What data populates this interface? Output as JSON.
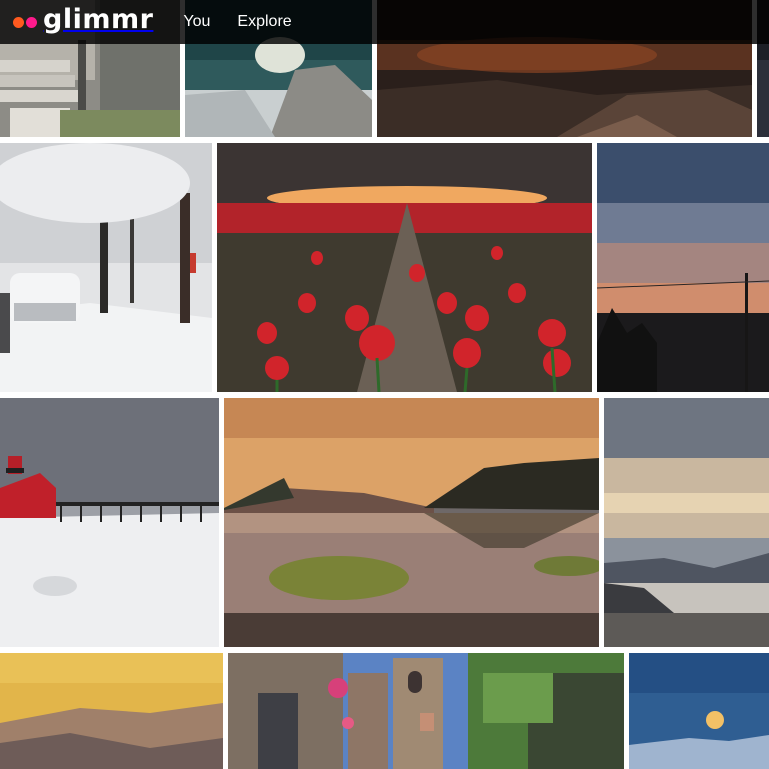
{
  "brand": {
    "name": "glimmr",
    "dot_colors": [
      "#ff5a1f",
      "#ff1a8c"
    ]
  },
  "nav": {
    "items": [
      {
        "label": "You"
      },
      {
        "label": "Explore"
      }
    ]
  },
  "gallery": {
    "photos": [
      {
        "subject": "stone stairs beside a building"
      },
      {
        "subject": "lake with rocks"
      },
      {
        "subject": "dark rocky landscape at sunset"
      },
      {
        "subject": "dark photo edge"
      },
      {
        "subject": "snowy tree-lined street with car"
      },
      {
        "subject": "field of red tulips at sunset"
      },
      {
        "subject": "sunset sky over fence silhouette"
      },
      {
        "subject": "red lighthouse on a snowy pier"
      },
      {
        "subject": "lake reflection at sunset"
      },
      {
        "subject": "coastline under cloudy sky"
      },
      {
        "subject": "hazy golden mountains"
      },
      {
        "subject": "stone village street with bell tower"
      },
      {
        "subject": "full moon over blue sky"
      }
    ]
  }
}
